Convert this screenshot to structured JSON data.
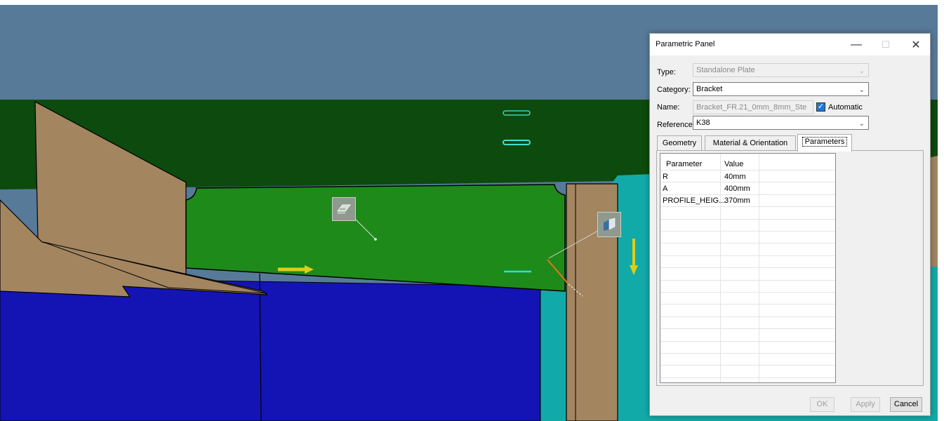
{
  "dialog": {
    "title": "Parametric Panel",
    "window_controls": [
      "—",
      "☐",
      "✕"
    ],
    "type_label": "Type:",
    "type_value": "Standalone Plate",
    "category_label": "Category:",
    "category_value": "Bracket",
    "name_label": "Name:",
    "name_value": "Bracket_FR.21_0mm_8mm_Ste",
    "automatic_label": "Automatic",
    "automatic_checked": true,
    "reference_label": "Reference:",
    "reference_value": "K38",
    "tabs": [
      {
        "label": "Geometry",
        "active": false
      },
      {
        "label": "Material & Orientation",
        "active": false
      },
      {
        "label": "Parameters",
        "active": true
      }
    ],
    "grid": {
      "columns": [
        "Parameter",
        "Value"
      ],
      "rows": [
        {
          "parameter": "R",
          "value": "40mm"
        },
        {
          "parameter": "A",
          "value": "400mm"
        },
        {
          "parameter": "PROFILE_HEIG...",
          "value": "370mm"
        }
      ]
    },
    "buttons": {
      "ok": "OK",
      "apply": "Apply",
      "cancel": "Cancel"
    }
  },
  "scene": {
    "icons": [
      "bracket-handle-icon",
      "profile-handle-icon",
      "direction-arrow-icon"
    ],
    "colors": {
      "sky": "#577a99",
      "dark_green": "#0d4a0d",
      "plate_green": "#1e8a1a",
      "tan": "#a38560",
      "blue": "#1414b4",
      "cyan": "#12aaa8",
      "yellow": "#dccf17"
    }
  }
}
